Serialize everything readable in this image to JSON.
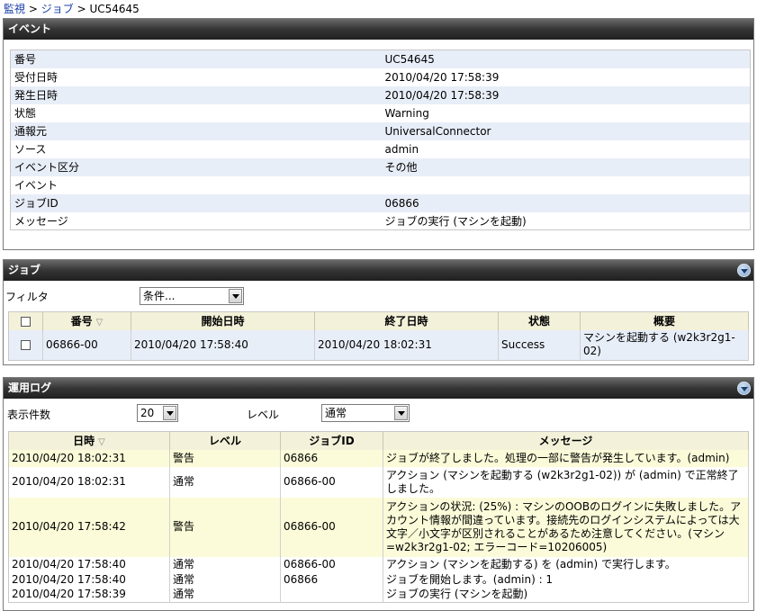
{
  "breadcrumb": {
    "items": [
      "監視",
      "ジョブ"
    ],
    "separator": ">",
    "current": "UC54645"
  },
  "event": {
    "title": "イベント",
    "rows": [
      {
        "label": "番号",
        "value": "UC54645"
      },
      {
        "label": "受付日時",
        "value": "2010/04/20 17:58:39"
      },
      {
        "label": "発生日時",
        "value": "2010/04/20 17:58:39"
      },
      {
        "label": "状態",
        "value": "Warning"
      },
      {
        "label": "通報元",
        "value": "UniversalConnector"
      },
      {
        "label": "ソース",
        "value": "admin"
      },
      {
        "label": "イベント区分",
        "value": "その他"
      },
      {
        "label": "イベント",
        "value": ""
      },
      {
        "label": "ジョブID",
        "value": "06866"
      },
      {
        "label": "メッセージ",
        "value": "ジョブの実行 (マシンを起動)"
      }
    ]
  },
  "jobs": {
    "title": "ジョブ",
    "filter_label": "フィルタ",
    "filter_value": "条件...",
    "columns": [
      "番号",
      "開始日時",
      "終了日時",
      "状態",
      "概要"
    ],
    "rows": [
      {
        "number": "06866-00",
        "start": "2010/04/20 17:58:40",
        "end": "2010/04/20 18:02:31",
        "status": "Success",
        "summary": "マシンを起動する (w2k3r2g1-02)"
      }
    ]
  },
  "oplog": {
    "title": "運用ログ",
    "count_label": "表示件数",
    "count_value": "20",
    "level_label": "レベル",
    "level_value": "通常",
    "columns": [
      "日時",
      "レベル",
      "ジョブID",
      "メッセージ"
    ],
    "rows": [
      {
        "datetime": "2010/04/20 18:02:31",
        "level": "警告",
        "job_id": "06866",
        "message": "ジョブが終了しました。処理の一部に警告が発生しています。(admin)"
      },
      {
        "datetime": "2010/04/20 18:02:31",
        "level": "通常",
        "job_id": "06866-00",
        "message": "アクション (マシンを起動する (w2k3r2g1-02)) が (admin) で正常終了しました。"
      },
      {
        "datetime": "2010/04/20 17:58:42",
        "level": "警告",
        "job_id": "06866-00",
        "message": "アクションの状況: (25%) : マシンのOOBのログインに失敗しました。アカウント情報が間違っています。接続先のログインシステムによっては大文字／小文字が区別されることがあるため注意してください。(マシン=w2k3r2g1-02; エラーコード=10206005)"
      },
      {
        "datetime": "2010/04/20 17:58:40",
        "level": "通常",
        "job_id": "06866-00",
        "message": "アクション (マシンを起動する) を (admin) で実行します。"
      },
      {
        "datetime": "2010/04/20 17:58:40",
        "level": "通常",
        "job_id": "06866",
        "message": "ジョブを開始します。(admin) : 1"
      },
      {
        "datetime": "2010/04/20 17:58:39",
        "level": "通常",
        "job_id": "",
        "message": "ジョブの実行 (マシンを起動)"
      }
    ]
  }
}
